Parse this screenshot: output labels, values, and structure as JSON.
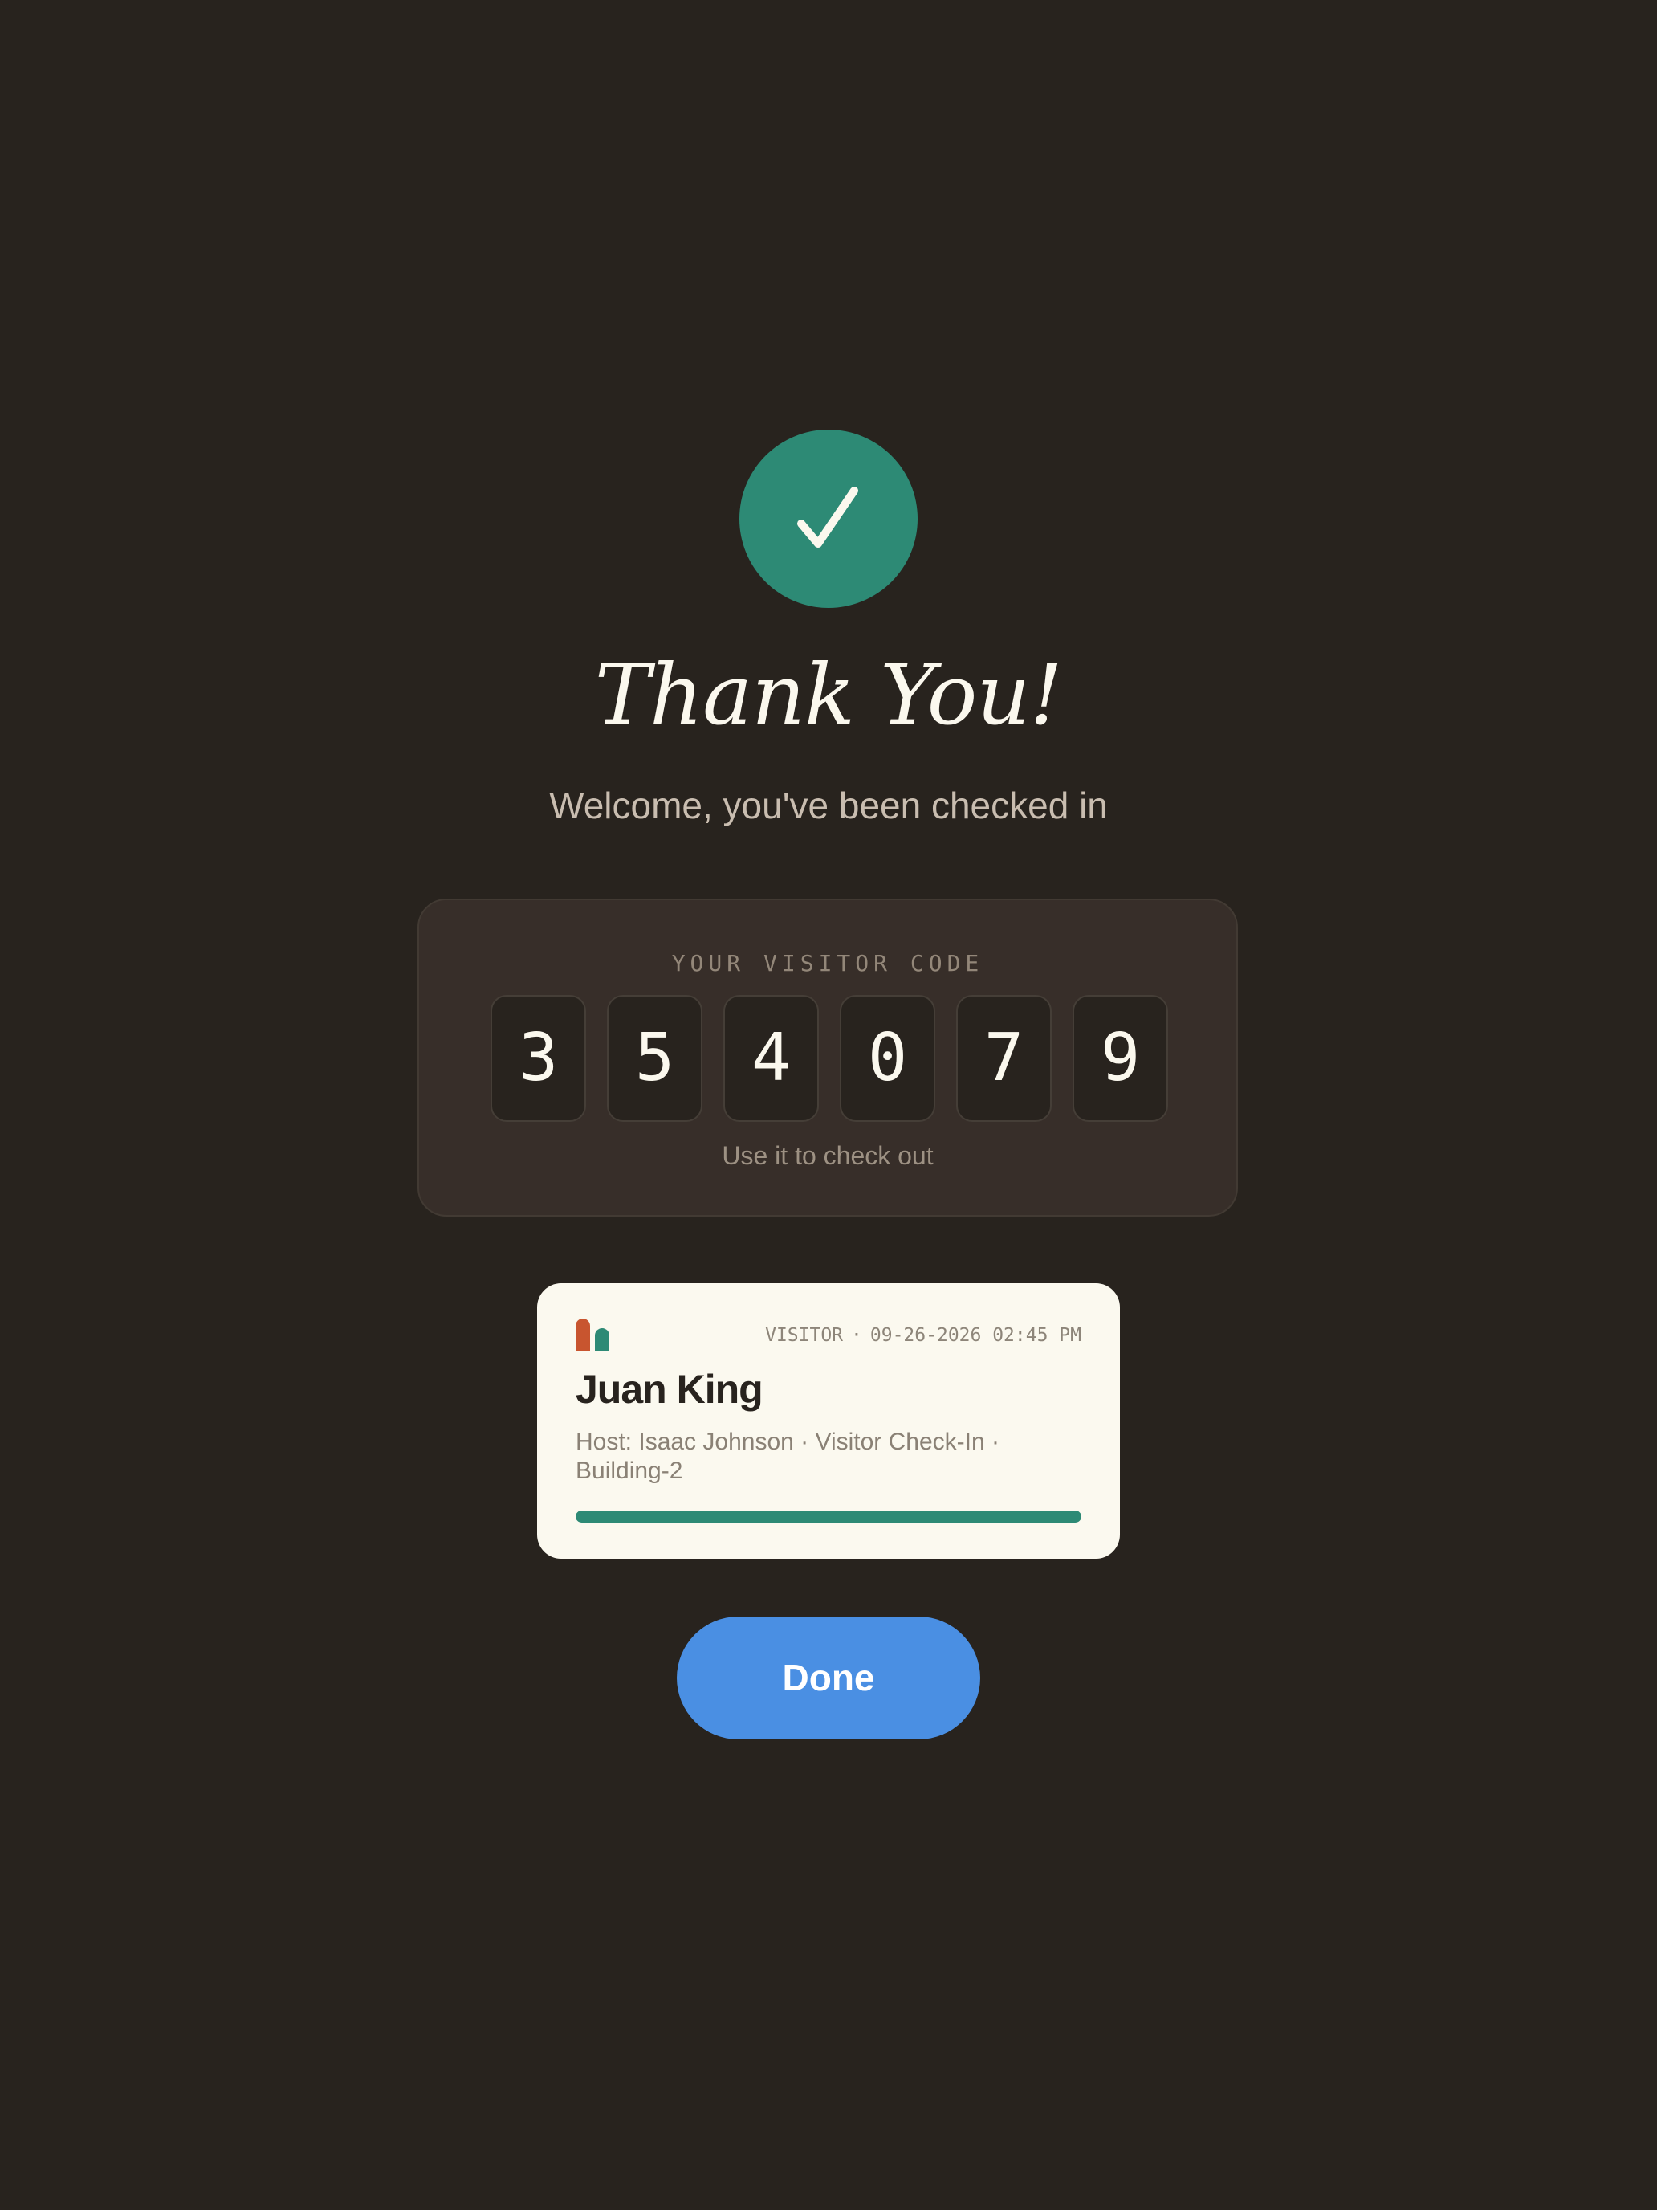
{
  "confirmation": {
    "icon": "checkmark-icon",
    "title": "Thank You!",
    "subtitle": "Welcome, you've been checked in"
  },
  "visitor_code": {
    "label": "YOUR VISITOR CODE",
    "digits": [
      "3",
      "5",
      "4",
      "0",
      "7",
      "9"
    ],
    "hint": "Use it to check out"
  },
  "badge": {
    "logo_icon": "building-logo-icon",
    "role": "VISITOR",
    "datetime": "09-26-2026 02:45 PM",
    "name": "Juan King",
    "details": "Host: Isaac Johnson · Visitor Check-In · Building-2"
  },
  "actions": {
    "done_label": "Done"
  },
  "colors": {
    "background": "#28231e",
    "success": "#2d8a75",
    "panel": "#372e29",
    "badge_background": "#fbf9ef",
    "logo_orange": "#c8552f",
    "primary_button": "#4a8fe3"
  }
}
